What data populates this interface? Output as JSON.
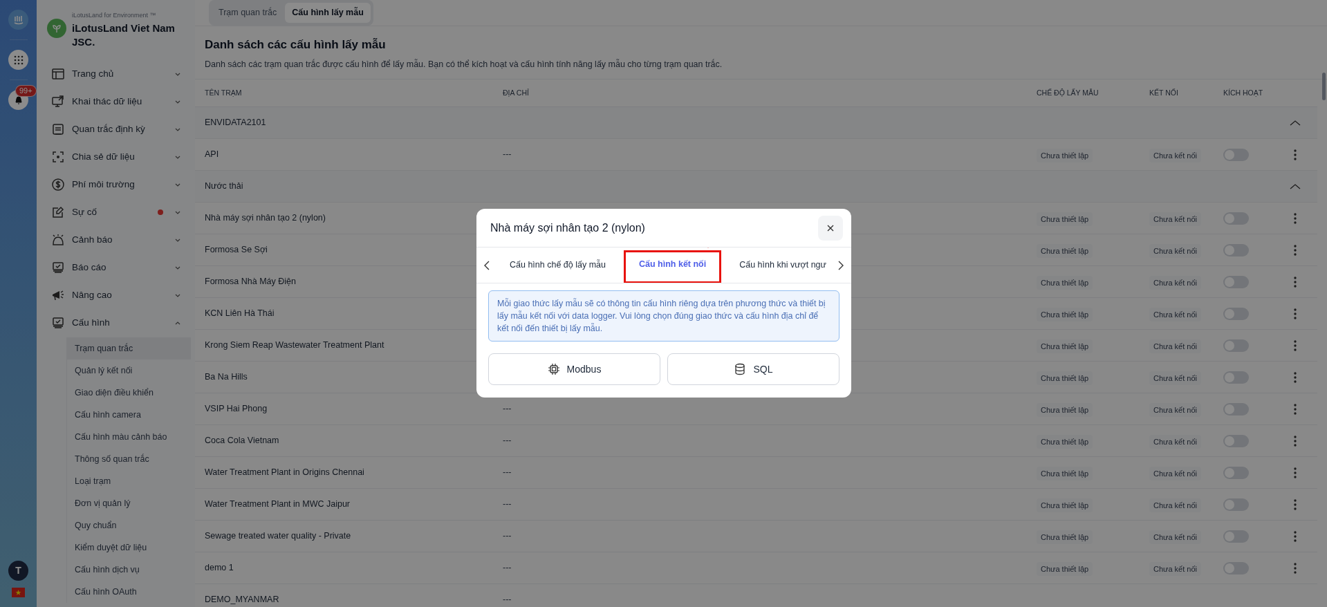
{
  "rail": {
    "notification_count": "99+",
    "avatar_initial": "T"
  },
  "brand": {
    "caption": "iLotusLand for Environment ™",
    "name": "iLotusLand Viet Nam JSC."
  },
  "sidebar": {
    "items": [
      {
        "label": "Trang chủ",
        "expanded": false,
        "alert": false
      },
      {
        "label": "Khai thác dữ liệu",
        "expanded": false,
        "alert": false
      },
      {
        "label": "Quan trắc định kỳ",
        "expanded": false,
        "alert": false
      },
      {
        "label": "Chia sẻ dữ liệu",
        "expanded": false,
        "alert": false
      },
      {
        "label": "Phí môi trường",
        "expanded": false,
        "alert": false
      },
      {
        "label": "Sự cố",
        "expanded": false,
        "alert": true
      },
      {
        "label": "Cảnh báo",
        "expanded": false,
        "alert": false
      },
      {
        "label": "Báo cáo",
        "expanded": false,
        "alert": false
      },
      {
        "label": "Nâng cao",
        "expanded": false,
        "alert": false
      },
      {
        "label": "Cấu hình",
        "expanded": true,
        "alert": false,
        "children": [
          {
            "label": "Trạm quan trắc",
            "selected": true
          },
          {
            "label": "Quản lý kết nối",
            "selected": false
          },
          {
            "label": "Giao diện điều khiển",
            "selected": false
          },
          {
            "label": "Cấu hình camera",
            "selected": false
          },
          {
            "label": "Cấu hình màu cảnh báo",
            "selected": false
          },
          {
            "label": "Thông số quan trắc",
            "selected": false
          },
          {
            "label": "Loại trạm",
            "selected": false
          },
          {
            "label": "Đơn vị quản lý",
            "selected": false
          },
          {
            "label": "Quy chuẩn",
            "selected": false
          },
          {
            "label": "Kiểm duyệt dữ liệu",
            "selected": false
          },
          {
            "label": "Cấu hình dịch vụ",
            "selected": false
          },
          {
            "label": "Cấu hình OAuth",
            "selected": false
          }
        ]
      }
    ]
  },
  "tabs": [
    {
      "label": "Trạm quan trắc",
      "selected": false
    },
    {
      "label": "Cấu hình lấy mẫu",
      "selected": true
    }
  ],
  "title": "Danh sách các cấu hình lấy mẫu",
  "subtitle": "Danh sách các trạm quan trắc được cấu hình để lấy mẫu. Bạn có thể kích hoạt và cấu hình tính năng lấy mẫu cho từng trạm quan trắc.",
  "table": {
    "columns": [
      "TÊN TRẠM",
      "ĐỊA CHỈ",
      "CHẾ ĐỘ LẤY MẪU",
      "KẾT NỐI",
      "KÍCH HOẠT"
    ],
    "groups": [
      {
        "name": "ENVIDATA2101",
        "expanded": true,
        "rows": [
          {
            "name": "API",
            "address": "---",
            "mode": "Chưa thiết lập",
            "connection": "Chưa kết nối",
            "active": false
          }
        ]
      },
      {
        "name": "Nước thải",
        "expanded": true,
        "rows": [
          {
            "name": "Nhà máy sợi nhân tạo 2 (nylon)",
            "mode": "Chưa thiết lập",
            "connection": "Chưa kết nối",
            "active": false
          },
          {
            "name": "Formosa Se Sợi",
            "mode": "Chưa thiết lập",
            "connection": "Chưa kết nối",
            "active": false
          },
          {
            "name": "Formosa Nhà Máy Điện",
            "mode": "Chưa thiết lập",
            "connection": "Chưa kết nối",
            "active": false
          },
          {
            "name": "KCN Liên Hà Thái",
            "mode": "Chưa thiết lập",
            "connection": "Chưa kết nối",
            "active": false
          },
          {
            "name": "Krong Siem Reap Wastewater Treatment Plant",
            "mode": "Chưa thiết lập",
            "connection": "Chưa kết nối",
            "active": false
          },
          {
            "name": "Ba Na Hills",
            "mode": "Chưa thiết lập",
            "connection": "Chưa kết nối",
            "active": false
          },
          {
            "name": "VSIP Hai Phong",
            "address": "---",
            "mode": "Chưa thiết lập",
            "connection": "Chưa kết nối",
            "active": false
          },
          {
            "name": "Coca Cola Vietnam",
            "address": "---",
            "mode": "Chưa thiết lập",
            "connection": "Chưa kết nối",
            "active": false
          },
          {
            "name": "Water Treatment Plant in Origins Chennai",
            "address": "---",
            "mode": "Chưa thiết lập",
            "connection": "Chưa kết nối",
            "active": false
          },
          {
            "name": "Water Treatment Plant in MWC Jaipur",
            "address": "---",
            "mode": "Chưa thiết lập",
            "connection": "Chưa kết nối",
            "active": false
          },
          {
            "name": "Sewage treated water quality - Private",
            "address": "---",
            "mode": "Chưa thiết lập",
            "connection": "Chưa kết nối",
            "active": false
          },
          {
            "name": "demo 1",
            "address": "---",
            "mode": "Chưa thiết lập",
            "connection": "Chưa kết nối",
            "active": false
          },
          {
            "name": "DEMO_MYANMAR",
            "address": "---"
          }
        ]
      }
    ]
  },
  "modal": {
    "title": "Nhà máy sợi nhân tạo 2 (nylon)",
    "tabs": [
      {
        "label": "Cấu hình chế độ lấy mẫu",
        "selected": false
      },
      {
        "label": "Cấu hình kết nối",
        "selected": true
      },
      {
        "label": "Cấu hình khi vượt ngư",
        "selected": false
      }
    ],
    "info": "Mỗi giao thức lấy mẫu sẽ có thông tin cấu hình riêng dựa trên phương thức và thiết bị lấy mẫu kết nối với data logger. Vui lòng chọn đúng giao thức và cấu hình địa chỉ để kết nối đến thiết bị lấy mẫu.",
    "buttons": [
      {
        "label": "Modbus"
      },
      {
        "label": "SQL"
      }
    ]
  }
}
